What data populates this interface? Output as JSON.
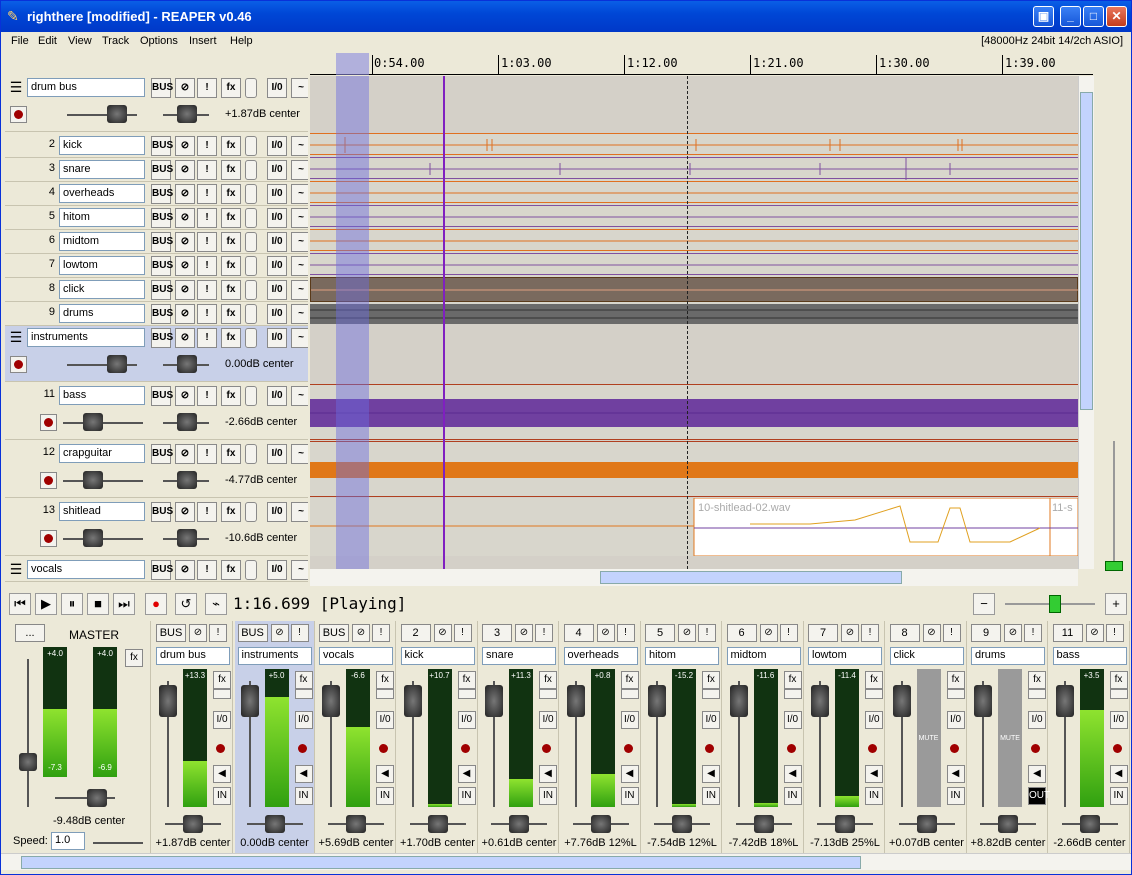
{
  "window": {
    "title": "righthere [modified] - REAPER v0.46"
  },
  "menu": [
    "File",
    "Edit",
    "View",
    "Track",
    "Options",
    "Insert",
    "Help"
  ],
  "audio_info": "[48000Hz 24bit 14/2ch ASIO]",
  "ruler": [
    "0:54.00",
    "1:03.00",
    "1:12.00",
    "1:21.00",
    "1:30.00",
    "1:39.00"
  ],
  "tcp": {
    "buttons": {
      "bus": "BUS",
      "solo": "!",
      "fx": "fx",
      "io": "I/0",
      "env": "~"
    },
    "tracks": [
      {
        "num": "",
        "name": "drum bus",
        "vol": "+1.87dB center",
        "folder": true
      },
      {
        "num": "2",
        "name": "kick"
      },
      {
        "num": "3",
        "name": "snare"
      },
      {
        "num": "4",
        "name": "overheads"
      },
      {
        "num": "5",
        "name": "hitom"
      },
      {
        "num": "6",
        "name": "midtom"
      },
      {
        "num": "7",
        "name": "lowtom"
      },
      {
        "num": "8",
        "name": "click"
      },
      {
        "num": "9",
        "name": "drums"
      },
      {
        "num": "",
        "name": "instruments",
        "vol": "0.00dB center",
        "folder": true
      },
      {
        "num": "11",
        "name": "bass",
        "vol": "-2.66dB center"
      },
      {
        "num": "12",
        "name": "crapguitar",
        "vol": "-4.77dB center"
      },
      {
        "num": "13",
        "name": "shitlead",
        "vol": "-10.6dB center"
      },
      {
        "num": "",
        "name": "vocals",
        "folder": true
      }
    ]
  },
  "items": {
    "shitlead_a": "10-shitlead-02.wav",
    "shitlead_b": "11-s"
  },
  "transport": {
    "status": "1:16.699 [Playing]",
    "zoom_minus": "−",
    "zoom_plus": "+"
  },
  "mixer": {
    "master": {
      "label": "MASTER",
      "browse": "...",
      "peakL": "+4.0",
      "peakR": "+4.0",
      "lowL": "-7.3",
      "lowR": "-6.9",
      "vol": "-9.48dB center",
      "speed_label": "Speed:",
      "speed": "1.0"
    },
    "labels": {
      "fx": "fx",
      "io": "I/0",
      "in": "IN",
      "out": "OUT",
      "mute": "MUTE",
      "solo": "!"
    },
    "strips": [
      {
        "tag": "BUS",
        "name": "drum bus",
        "peak": "+13.3",
        "vol": "+1.87dB center",
        "level": 0.33
      },
      {
        "tag": "BUS",
        "name": "instruments",
        "peak": "+5.0",
        "vol": "0.00dB center",
        "level": 0.8,
        "sel": true
      },
      {
        "tag": "BUS",
        "name": "vocals",
        "peak": "-6.6",
        "vol": "+5.69dB center",
        "level": 0.58
      },
      {
        "tag": "2",
        "name": "kick",
        "peak": "+10.7",
        "vol": "+1.70dB center",
        "level": 0.02
      },
      {
        "tag": "3",
        "name": "snare",
        "peak": "+11.3",
        "vol": "+0.61dB center",
        "level": 0.2
      },
      {
        "tag": "4",
        "name": "overheads",
        "peak": "+0.8",
        "vol": "+7.76dB 12%L",
        "level": 0.24
      },
      {
        "tag": "5",
        "name": "hitom",
        "peak": "-15.2",
        "vol": "-7.54dB 12%L",
        "level": 0.02
      },
      {
        "tag": "6",
        "name": "midtom",
        "peak": "-11.6",
        "vol": "-7.42dB 18%L",
        "level": 0.03
      },
      {
        "tag": "7",
        "name": "lowtom",
        "peak": "-11.4",
        "vol": "-7.13dB 25%L",
        "level": 0.08
      },
      {
        "tag": "8",
        "name": "click",
        "peak": "",
        "vol": "+0.07dB center",
        "muted": true
      },
      {
        "tag": "9",
        "name": "drums",
        "peak": "",
        "vol": "+8.82dB center",
        "muted": true
      },
      {
        "tag": "11",
        "name": "bass",
        "peak": "+3.5",
        "vol": "-2.66dB center",
        "level": 0.7
      }
    ]
  }
}
